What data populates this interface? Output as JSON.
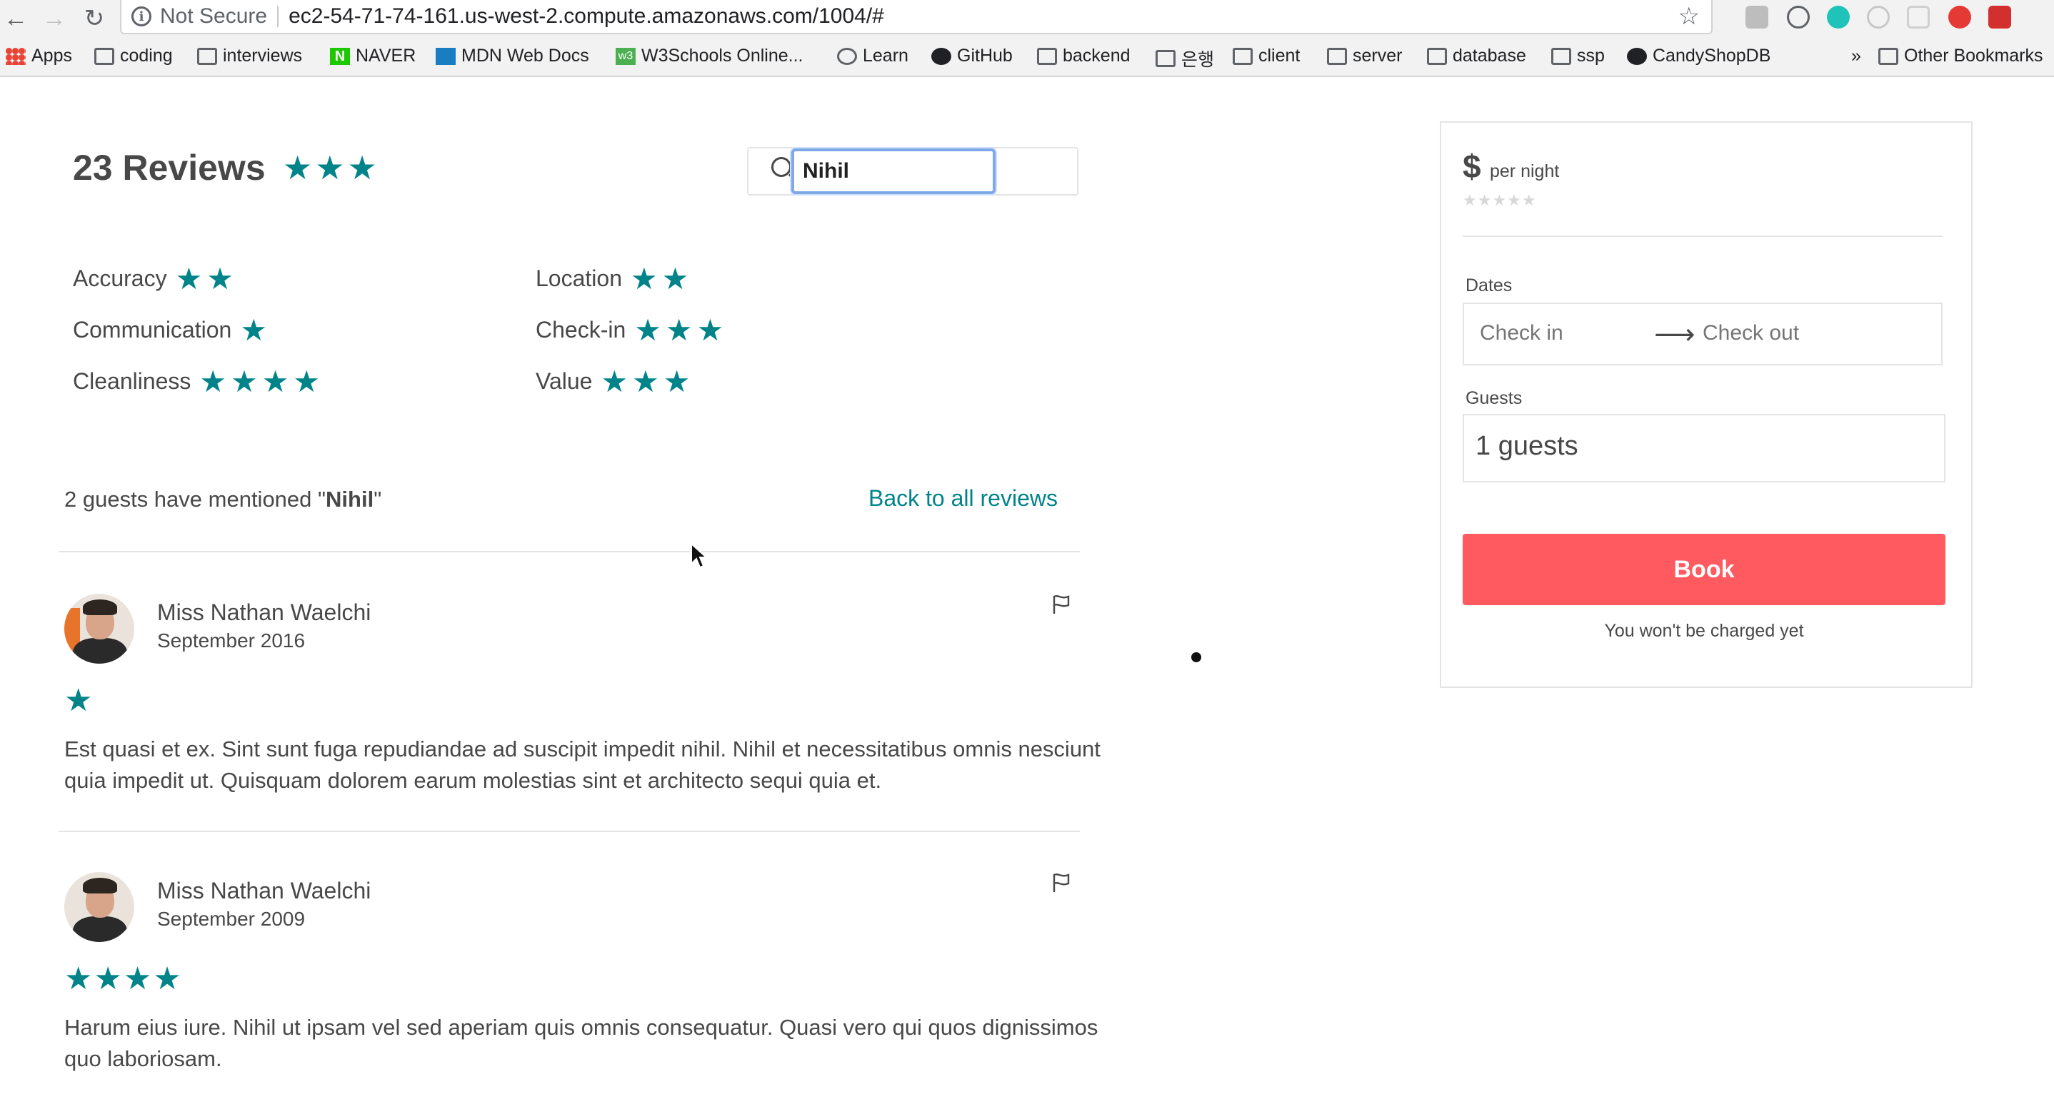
{
  "browser": {
    "security_label": "Not Secure",
    "url": "ec2-54-71-74-161.us-west-2.compute.amazonaws.com/1004/#",
    "bookmarks": [
      "Apps",
      "coding",
      "interviews",
      "NAVER",
      "MDN Web Docs",
      "W3Schools Online...",
      "Learn",
      "GitHub",
      "backend",
      "은행",
      "client",
      "server",
      "database",
      "ssp",
      "CandyShopDB"
    ],
    "overflow_label": "»",
    "other_bookmarks": "Other Bookmarks"
  },
  "reviews": {
    "title": "23 Reviews",
    "overall_stars": "★★★",
    "search_value": "Nihil",
    "categories": [
      {
        "label": "Accuracy",
        "stars": "★★"
      },
      {
        "label": "Communication",
        "stars": "★"
      },
      {
        "label": "Cleanliness",
        "stars": "★★★★"
      },
      {
        "label": "Location",
        "stars": "★★"
      },
      {
        "label": "Check-in",
        "stars": "★★★"
      },
      {
        "label": "Value",
        "stars": "★★★"
      }
    ],
    "mention_prefix": "2 guests have mentioned \"",
    "mention_term": "Nihil",
    "mention_suffix": "\"",
    "back_link": "Back to all reviews",
    "items": [
      {
        "name": "Miss Nathan Waelchi",
        "date": "September 2016",
        "stars": "★",
        "text": "Est quasi et ex. Sint sunt fuga repudiandae ad suscipit impedit nihil. Nihil et necessitatibus omnis nesciunt quia impedit ut. Quisquam dolorem earum molestias sint et architecto sequi quia et."
      },
      {
        "name": "Miss Nathan Waelchi",
        "date": "September 2009",
        "stars": "★★★★",
        "text": "Harum eius iure. Nihil ut ipsam vel sed aperiam quis omnis consequatur. Quasi vero qui quos dignissimos quo laboriosam."
      }
    ]
  },
  "booking": {
    "currency": "$",
    "per_night": "per night",
    "stars": "★★★★★",
    "dates_label": "Dates",
    "check_in": "Check in",
    "check_out": "Check out",
    "guests_label": "Guests",
    "guests_value": "1 guests",
    "book_label": "Book",
    "note": "You won't be charged yet"
  },
  "colors": {
    "accent": "#008489",
    "book_button": "#ff5a5f",
    "text": "#484848"
  }
}
